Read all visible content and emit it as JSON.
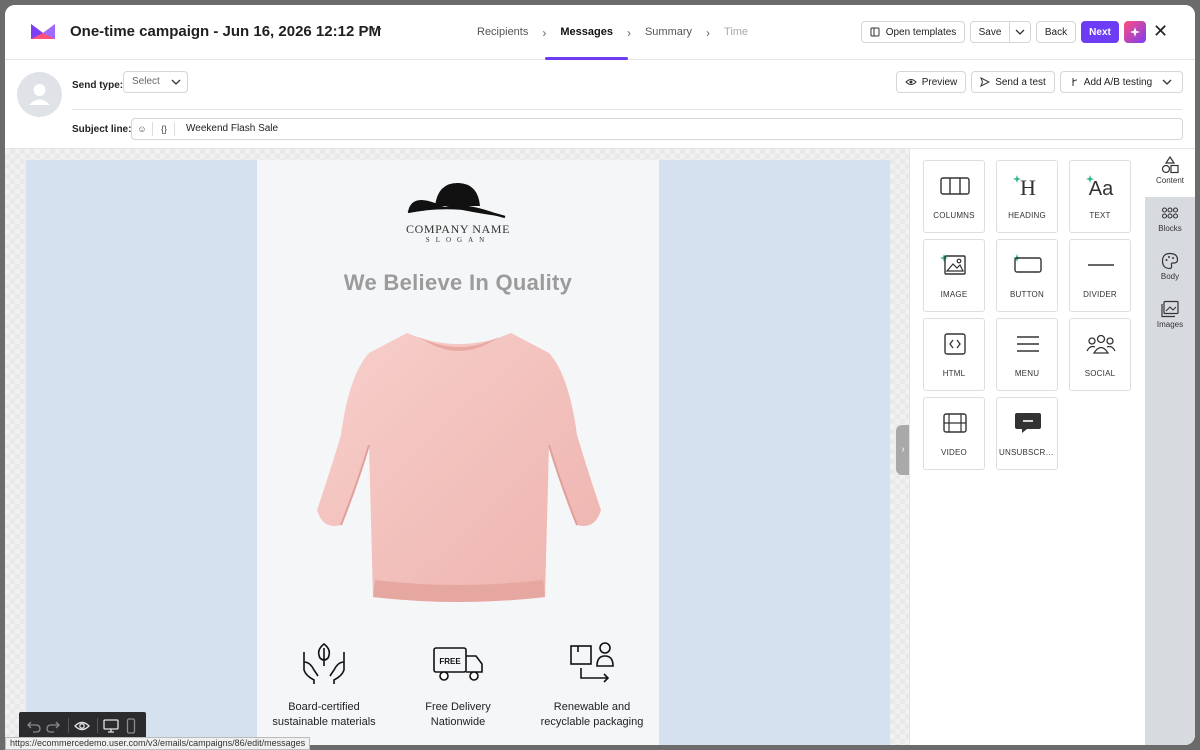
{
  "header": {
    "title": "One-time campaign - Jun 16, 2026 12:12 PM",
    "more": "···",
    "steps": [
      {
        "label": "Recipients",
        "state": "done"
      },
      {
        "label": "Messages",
        "state": "active"
      },
      {
        "label": "Summary",
        "state": "todo"
      },
      {
        "label": "Time",
        "state": "disabled"
      }
    ],
    "open_templates": "Open templates",
    "save": "Save",
    "back": "Back",
    "next": "Next"
  },
  "settings": {
    "send_type_label": "Send type:",
    "send_type_value": "Select",
    "preview": "Preview",
    "send_test": "Send a test",
    "ab_testing": "Add A/B testing",
    "subject_label": "Subject line:",
    "subject_value": "Weekend Flash Sale",
    "var_icon": "{}"
  },
  "email": {
    "company_name": "COMPANY NAME",
    "slogan": "SLOGAN",
    "headline": "We Believe In Quality",
    "features": [
      {
        "line1": "Board-certified",
        "line2": "sustainable materials"
      },
      {
        "line1": "Free Delivery",
        "line2": "Nationwide"
      },
      {
        "line1": "Renewable and",
        "line2": "recyclable packaging"
      }
    ],
    "truck_text": "FREE"
  },
  "tools": [
    {
      "label": "COLUMNS",
      "icon": "columns-icon",
      "ai": false
    },
    {
      "label": "HEADING",
      "icon": "heading-icon",
      "ai": true
    },
    {
      "label": "TEXT",
      "icon": "text-icon",
      "ai": true
    },
    {
      "label": "IMAGE",
      "icon": "image-icon",
      "ai": true
    },
    {
      "label": "BUTTON",
      "icon": "button-icon",
      "ai": true
    },
    {
      "label": "DIVIDER",
      "icon": "divider-icon",
      "ai": false
    },
    {
      "label": "HTML",
      "icon": "html-icon",
      "ai": false
    },
    {
      "label": "MENU",
      "icon": "menu-icon",
      "ai": false
    },
    {
      "label": "SOCIAL",
      "icon": "social-icon",
      "ai": false
    },
    {
      "label": "VIDEO",
      "icon": "video-icon",
      "ai": false
    },
    {
      "label": "UNSUBSCRI...",
      "icon": "unsubscribe-icon",
      "ai": false
    }
  ],
  "tool_glyphs": {
    "heading": "H",
    "text": "Aa"
  },
  "rail": [
    {
      "label": "Content",
      "active": true
    },
    {
      "label": "Blocks",
      "active": false
    },
    {
      "label": "Body",
      "active": false
    },
    {
      "label": "Images",
      "active": false
    }
  ],
  "status_url": "https://ecommercedemo.user.com/v3/emails/campaigns/86/edit/messages",
  "colors": {
    "accent": "#6d3df5",
    "panel_blue": "#d5e1ef",
    "sweater": "#f4c3c0",
    "ai_sparkle": "#2bb58a"
  }
}
